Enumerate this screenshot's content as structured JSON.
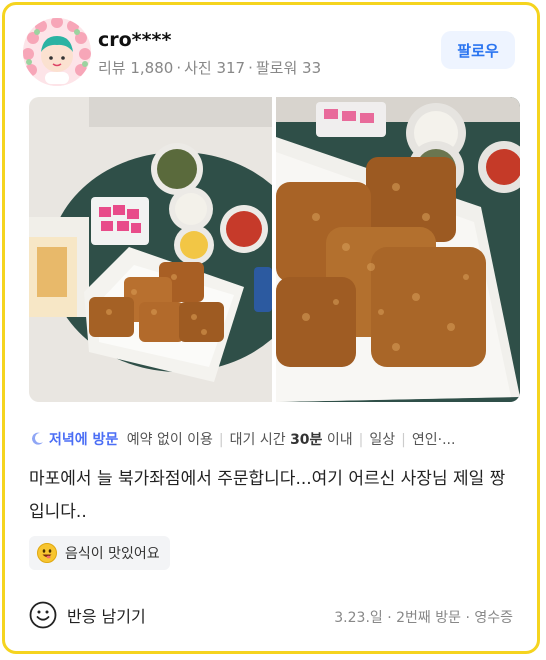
{
  "profile": {
    "username": "cro****",
    "stats": [
      "리뷰 1,880",
      "사진 317",
      "팔로워 33"
    ],
    "follow_label": "팔로우"
  },
  "tags": {
    "primary": "저녁에 방문",
    "secondary_prefix": "예약 없이 이용",
    "wait_prefix": "대기 시간 ",
    "wait_bold": "30분",
    "wait_suffix": " 이내",
    "purpose": "일상",
    "companion": "연인·..."
  },
  "review": {
    "text": "마포에서 늘 북가좌점에서 주문합니다...여기 어르신 사장님 제일 짱입니다.."
  },
  "keyword": {
    "label": "음식이 맛있어요",
    "icon": "yummy-face-icon"
  },
  "footer": {
    "react_label": "반응 남기기",
    "visit_meta": "3.23.일 · 2번째 방문 · 영수증"
  },
  "colors": {
    "card_border": "#f5d41f",
    "follow_bg": "#eef4ff",
    "follow_text": "#2a74f0",
    "tag_primary": "#4b6ef5"
  }
}
